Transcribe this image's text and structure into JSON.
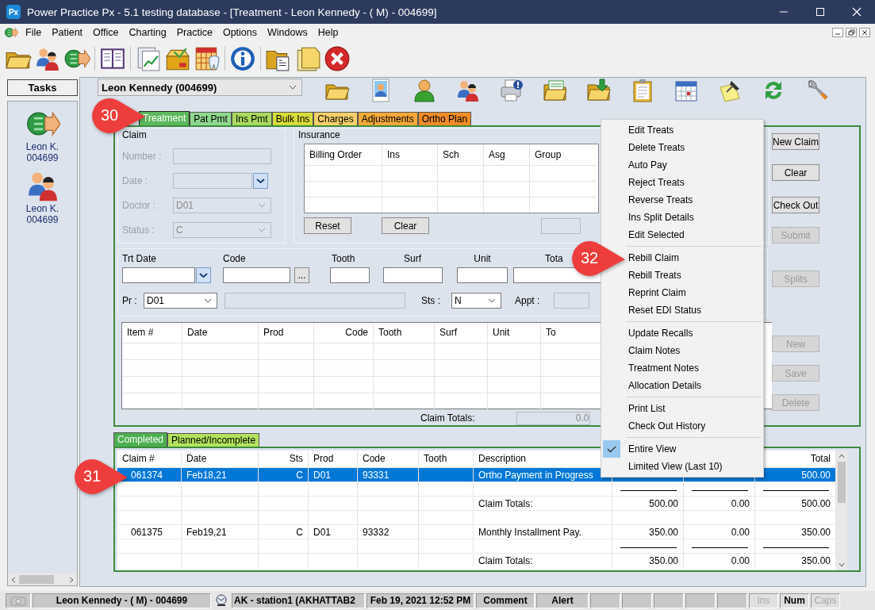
{
  "window": {
    "logo": "Px",
    "title": "Power Practice Px - 5.1 testing database - [Treatment - Leon Kennedy - ( M) - 004699]"
  },
  "menu_bar": [
    "File",
    "Patient",
    "Office",
    "Charting",
    "Practice",
    "Options",
    "Windows",
    "Help"
  ],
  "tasks": {
    "title": "Tasks",
    "items": [
      {
        "name": "Leon K.",
        "number": "004699"
      },
      {
        "name": "Leon K.",
        "number": "004699"
      }
    ]
  },
  "patient_selector": {
    "value": "Leon Kennedy (004699)"
  },
  "tabs": [
    {
      "label": "Treatment",
      "selected": true,
      "color": "#5cb85c"
    },
    {
      "label": "Pat Pmt",
      "selected": false,
      "color": "#8fd88f"
    },
    {
      "label": "Ins Pmt",
      "selected": false,
      "color": "#a9d95e"
    },
    {
      "label": "Bulk Ins",
      "selected": false,
      "color": "#d6dc3a"
    },
    {
      "label": "Charges",
      "selected": false,
      "color": "#f5d06a"
    },
    {
      "label": "Adjustments",
      "selected": false,
      "color": "#f5a83a"
    },
    {
      "label": "Ortho Plan",
      "selected": false,
      "color": "#f08c26"
    }
  ],
  "claim": {
    "title": "Claim",
    "fields": [
      {
        "label": "Number :",
        "kind": "text",
        "disabled": true
      },
      {
        "label": "Date :",
        "kind": "date",
        "disabled": true
      },
      {
        "label": "Doctor :",
        "kind": "combo",
        "value": "D01",
        "disabled": true
      },
      {
        "label": "Status :",
        "kind": "combo",
        "value": "C",
        "disabled": true
      }
    ]
  },
  "insurance": {
    "title": "Insurance",
    "columns": [
      "Billing Order",
      "Ins",
      "Sch",
      "Asg",
      "Group"
    ],
    "buttons": [
      "Reset",
      "Clear"
    ]
  },
  "entry": {
    "fields": [
      {
        "label": "Trt Date",
        "kind": "date"
      },
      {
        "label": "Code",
        "kind": "lookup"
      },
      {
        "label": "Tooth",
        "kind": "text"
      },
      {
        "label": "Surf",
        "kind": "text"
      },
      {
        "label": "Unit",
        "kind": "text"
      },
      {
        "label": "Tota",
        "kind": "text"
      }
    ],
    "lookup_button": "...",
    "provider": {
      "label": "Pr :",
      "value": "D01"
    },
    "status": {
      "label": "Sts :",
      "value": "N"
    },
    "appointment": {
      "label": "Appt :"
    }
  },
  "items_table": {
    "columns": [
      "Item #",
      "Date",
      "Prod",
      "Code",
      "Tooth",
      "Surf",
      "Unit",
      "To"
    ],
    "totals_label": "Claim Totals:",
    "totals_value": "0.0"
  },
  "side_buttons": [
    {
      "label": "New Claim",
      "disabled": false
    },
    {
      "label": "Clear",
      "disabled": false
    },
    {
      "label": "Check Out",
      "disabled": false
    },
    {
      "label": "Submit",
      "disabled": true
    },
    {
      "label": "Splits",
      "disabled": true
    },
    {
      "label": "New",
      "disabled": true
    },
    {
      "label": "Save",
      "disabled": true
    },
    {
      "label": "Delete",
      "disabled": true
    }
  ],
  "list_tabs": [
    {
      "label": "Completed",
      "selected": true,
      "color": "#4caf50"
    },
    {
      "label": "Planned/Incomplete",
      "selected": false,
      "color": "#b3e35e"
    }
  ],
  "claims_table": {
    "columns": [
      "Claim #",
      "Date",
      "Sts",
      "Prod",
      "Code",
      "Tooth",
      "Description",
      null,
      null,
      "Total"
    ],
    "rows": [
      {
        "kind": "item",
        "selected": true,
        "cells": [
          "061374",
          "Feb18,21",
          "C",
          "D01",
          "93331",
          null,
          "Ortho Payment in Progress",
          null,
          null,
          "500.00"
        ]
      },
      {
        "kind": "rule",
        "selected": false
      },
      {
        "kind": "totals",
        "selected": false,
        "cells": [
          null,
          null,
          null,
          null,
          null,
          null,
          "Claim Totals:",
          "500.00",
          "0.00",
          "500.00"
        ]
      },
      {
        "kind": "blank",
        "selected": false
      },
      {
        "kind": "item",
        "selected": false,
        "cells": [
          "061375",
          "Feb19,21",
          "C",
          "D01",
          "93332",
          null,
          "Monthly Installment Pay.",
          "350.00",
          "0.00",
          "350.00"
        ]
      },
      {
        "kind": "rule",
        "selected": false
      },
      {
        "kind": "totals",
        "selected": false,
        "cells": [
          null,
          null,
          null,
          null,
          null,
          null,
          "Claim Totals:",
          "350.00",
          "0.00",
          "350.00"
        ]
      }
    ]
  },
  "context_menu": {
    "groups": [
      [
        {
          "label": "Edit Treats",
          "checked": false
        },
        {
          "label": "Delete Treats",
          "checked": false
        },
        {
          "label": "Auto Pay",
          "checked": false
        },
        {
          "label": "Reject Treats",
          "checked": false
        },
        {
          "label": "Reverse Treats",
          "checked": false
        },
        {
          "label": "Ins Split Details",
          "checked": false
        },
        {
          "label": "Edit Selected",
          "checked": false
        }
      ],
      [
        {
          "label": "Rebill Claim",
          "checked": false
        },
        {
          "label": "Rebill Treats",
          "checked": false
        },
        {
          "label": "Reprint Claim",
          "checked": false
        },
        {
          "label": "Reset EDI Status",
          "checked": false
        }
      ],
      [
        {
          "label": "Update Recalls",
          "checked": false
        },
        {
          "label": "Claim Notes",
          "checked": false
        },
        {
          "label": "Treatment Notes",
          "checked": false
        },
        {
          "label": "Allocation Details",
          "checked": false
        }
      ],
      [
        {
          "label": "Print List",
          "checked": false
        },
        {
          "label": "Check Out History",
          "checked": false
        }
      ],
      [
        {
          "label": "Entire View",
          "checked": true
        },
        {
          "label": "Limited View (Last 10)",
          "checked": false
        }
      ]
    ]
  },
  "callouts": [
    {
      "label": "30"
    },
    {
      "label": "31"
    },
    {
      "label": "32"
    }
  ],
  "status_bar": {
    "patient": "Leon Kennedy - ( M) - 004699",
    "station": "AK - station1 (AKHATTAB2",
    "datetime": "Feb 19, 2021 12:52 PM",
    "comment": "Comment",
    "alert": "Alert",
    "keys": [
      {
        "label": "Ins",
        "on": false
      },
      {
        "label": "Num",
        "on": true
      },
      {
        "label": "Caps",
        "on": false
      }
    ]
  }
}
